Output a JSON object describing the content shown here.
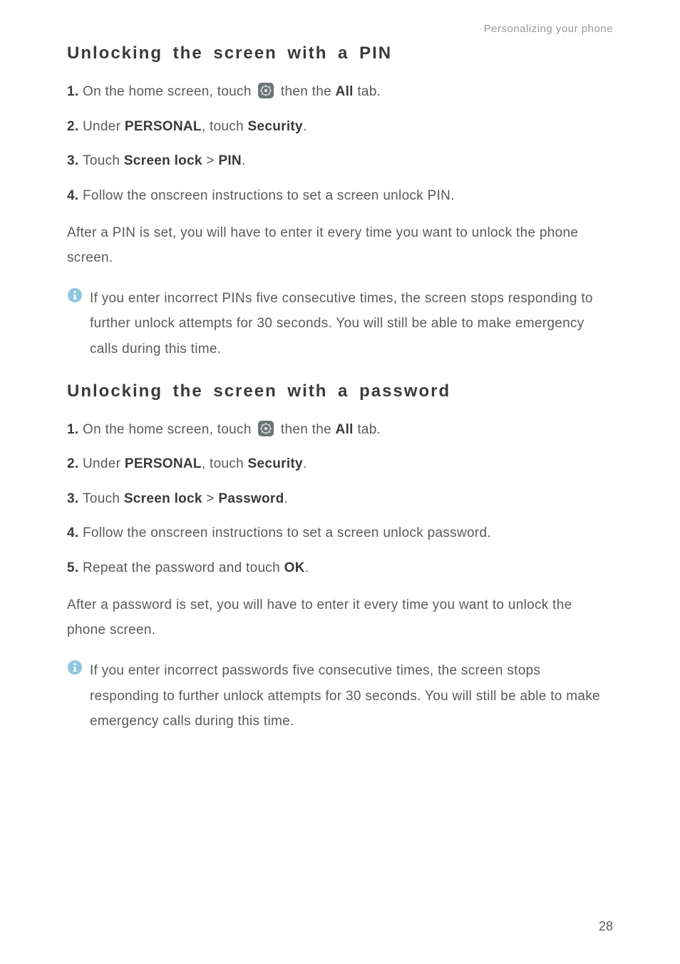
{
  "header": {
    "breadcrumb": "Personalizing your phone"
  },
  "section1": {
    "heading": "Unlocking the screen with a PIN",
    "steps": {
      "s1_num": "1. ",
      "s1_a": "On the home screen, touch ",
      "s1_b": " then the ",
      "s1_all": "All",
      "s1_c": " tab.",
      "s2_num": "2. ",
      "s2_a": "Under ",
      "s2_personal": "PERSONAL",
      "s2_b": ", touch ",
      "s2_security": "Security",
      "s2_c": ".",
      "s3_num": "3. ",
      "s3_a": "Touch ",
      "s3_screenlock": "Screen lock",
      "s3_gt": " > ",
      "s3_pin": "PIN",
      "s3_c": ".",
      "s4_num": "4. ",
      "s4_a": "Follow the onscreen instructions to set a screen unlock PIN."
    },
    "after": "After a PIN is set, you will have to enter it every time you want to unlock the phone screen.",
    "note": "If you enter incorrect PINs five consecutive times, the screen stops responding to further unlock attempts for 30 seconds. You will still be able to make emergency calls during this time."
  },
  "section2": {
    "heading": "Unlocking the screen with a password",
    "steps": {
      "s1_num": "1. ",
      "s1_a": "On the home screen, touch ",
      "s1_b": " then the ",
      "s1_all": "All",
      "s1_c": " tab.",
      "s2_num": "2. ",
      "s2_a": "Under ",
      "s2_personal": "PERSONAL",
      "s2_b": ", touch ",
      "s2_security": "Security",
      "s2_c": ".",
      "s3_num": "3. ",
      "s3_a": "Touch ",
      "s3_screenlock": "Screen lock",
      "s3_gt": " > ",
      "s3_password": "Password",
      "s3_c": ".",
      "s4_num": "4. ",
      "s4_a": "Follow the onscreen instructions to set a screen unlock password.",
      "s5_num": "5. ",
      "s5_a": "Repeat the password and touch ",
      "s5_ok": "OK",
      "s5_b": "."
    },
    "after": "After a password is set, you will have to enter it every time you want to unlock the phone screen.",
    "note": "If you enter incorrect passwords five consecutive times, the screen stops responding to further unlock attempts for 30 seconds. You will still be able to make emergency calls during this time."
  },
  "page_number": "28"
}
